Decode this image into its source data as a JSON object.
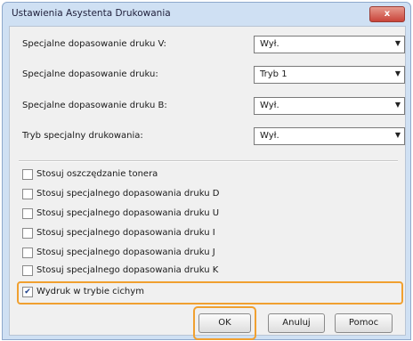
{
  "window": {
    "title": "Ustawienia Asystenta Drukowania",
    "close_label": "x"
  },
  "settings": [
    {
      "label": "Specjalne dopasowanie druku V:",
      "value": "Wył."
    },
    {
      "label": "Specjalne dopasowanie druku:",
      "value": "Tryb 1"
    },
    {
      "label": "Specjalne dopasowanie druku B:",
      "value": "Wył."
    },
    {
      "label": "Tryb specjalny drukowania:",
      "value": "Wył."
    }
  ],
  "checkboxes": [
    {
      "label": "Stosuj oszczędzanie tonera",
      "checked": false
    },
    {
      "label": "Stosuj specjalnego dopasowania druku D",
      "checked": false
    },
    {
      "label": "Stosuj specjalnego dopasowania druku U",
      "checked": false
    },
    {
      "label": "Stosuj specjalnego dopasowania druku I",
      "checked": false
    },
    {
      "label": "Stosuj specjalnego dopasowania druku J",
      "checked": false
    },
    {
      "label": "Stosuj specjalnego dopasowania druku K",
      "checked": false
    },
    {
      "label": "Wydruk w trybie cichym",
      "checked": true
    }
  ],
  "buttons": {
    "ok": "OK",
    "cancel": "Anuluj",
    "help": "Pomoc"
  },
  "colors": {
    "highlight": "#f0a030",
    "titlebar": "#cfe0f3"
  }
}
